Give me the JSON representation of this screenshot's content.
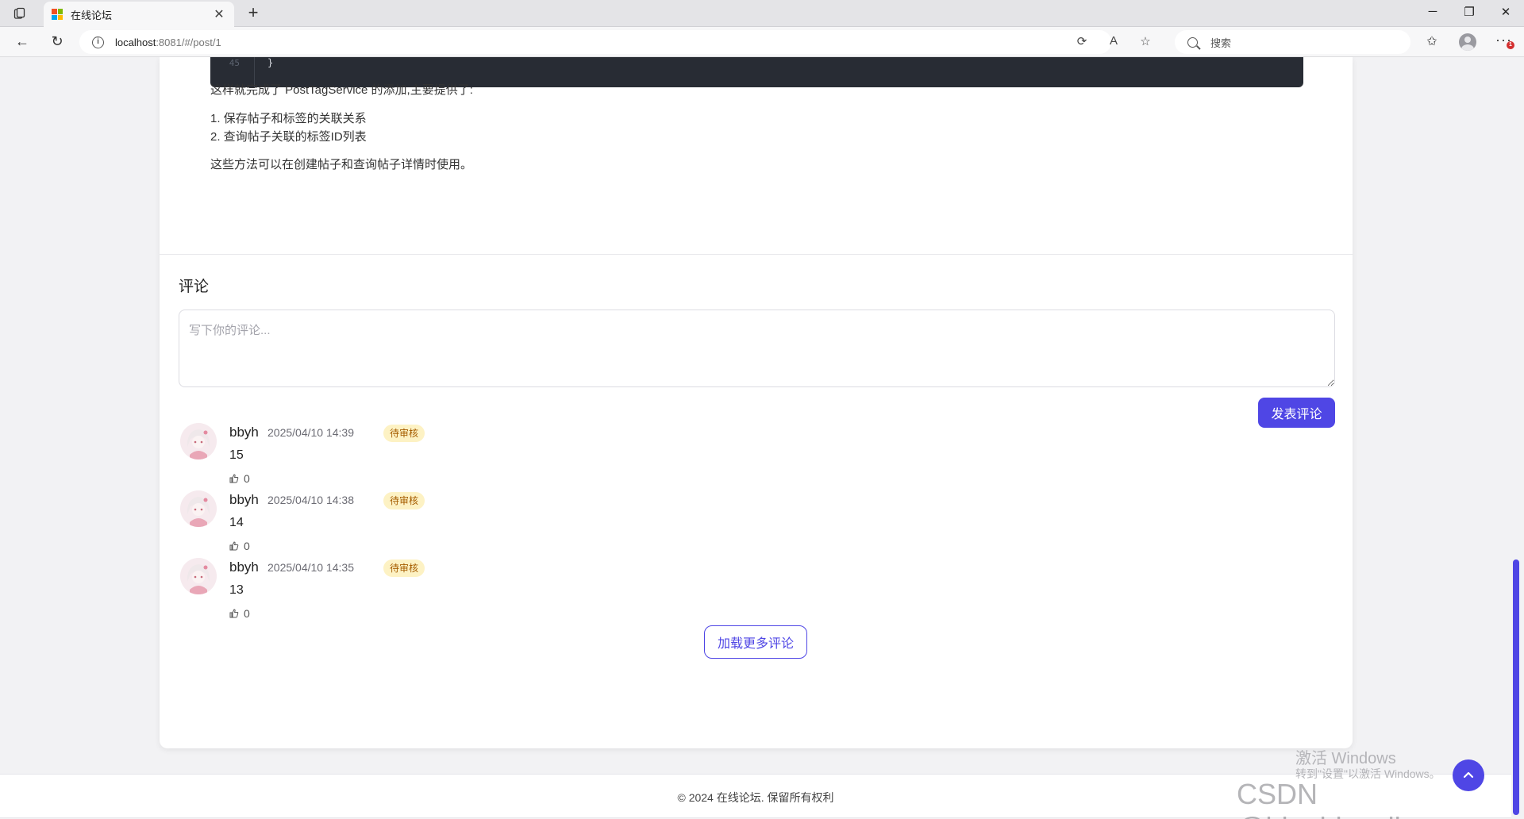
{
  "browser": {
    "tab_title": "在线论坛",
    "url_host": "localhost",
    "url_rest": ":8081/#/post/1",
    "search_placeholder": "搜索",
    "notification_count": "1"
  },
  "post": {
    "code_line_number": "45",
    "code_text": "}",
    "summary_intro": "这样就完成了 PostTagService 的添加,主要提供了:",
    "summary_points": [
      "1. 保存帖子和标签的关联关系",
      "2. 查询帖子关联的标签ID列表"
    ],
    "summary_outro": "这些方法可以在创建帖子和查询帖子详情时使用。"
  },
  "comments": {
    "title": "评论",
    "input_placeholder": "写下你的评论...",
    "submit_label": "发表评论",
    "items": [
      {
        "user": "bbyh",
        "time": "2025/04/10 14:39",
        "status": "待审核",
        "content": "15",
        "likes": "0"
      },
      {
        "user": "bbyh",
        "time": "2025/04/10 14:38",
        "status": "待审核",
        "content": "14",
        "likes": "0"
      },
      {
        "user": "bbyh",
        "time": "2025/04/10 14:35",
        "status": "待审核",
        "content": "13",
        "likes": "0"
      }
    ],
    "load_more_label": "加载更多评论"
  },
  "footer": {
    "text": "© 2024 在线论坛. 保留所有权利"
  },
  "overlay": {
    "activate_title": "激活 Windows",
    "activate_sub": "转到\"设置\"以激活 Windows。",
    "watermark": "CSDN @bingbingyihao"
  },
  "colors": {
    "accent": "#4f46e5",
    "badge_bg": "#fdf2c4",
    "badge_text": "#a65d00",
    "code_bg": "#282c34"
  }
}
